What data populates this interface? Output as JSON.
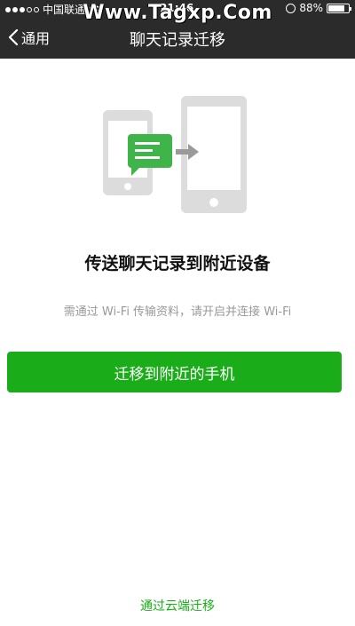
{
  "status_bar": {
    "carrier": "中国联通",
    "time": "21:46",
    "battery_text": "88%",
    "battery_level": 0.88
  },
  "watermark": "Www.Tagxp.Com",
  "nav": {
    "back_label": "通用",
    "title": "聊天记录迁移"
  },
  "content": {
    "heading": "传送聊天记录到附近设备",
    "subtext": "需通过 Wi-Fi 传输资料，请开启并连接 Wi-Fi",
    "primary_button": "迁移到附近的手机",
    "cloud_link": "通过云端迁移"
  },
  "colors": {
    "nav_bg": "#2b2b2b",
    "accent_green": "#1aad19",
    "device_gray": "#dcdcdc",
    "chat_bubble_green": "#3fb449"
  }
}
